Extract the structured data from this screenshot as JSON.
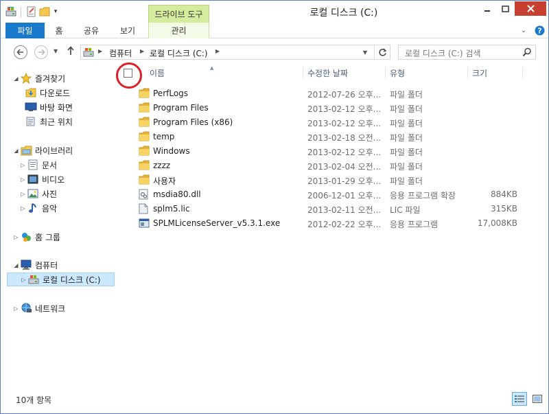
{
  "window": {
    "title": "로컬 디스크 (C:)",
    "context_tab": "드라이브 도구"
  },
  "ribbon": {
    "tabs": [
      {
        "id": "file",
        "label": "파일"
      },
      {
        "id": "home",
        "label": "홈"
      },
      {
        "id": "share",
        "label": "공유"
      },
      {
        "id": "view",
        "label": "보기"
      },
      {
        "id": "manage",
        "label": "관리"
      }
    ]
  },
  "address": {
    "breadcrumbs": [
      "컴퓨터",
      "로컬 디스크 (C:)"
    ]
  },
  "search": {
    "placeholder": "로컬 디스크 (C:) 검색"
  },
  "navpane": {
    "favorites": {
      "label": "즐겨찾기",
      "items": [
        "다운로드",
        "바탕 화면",
        "최근 위치"
      ]
    },
    "libraries": {
      "label": "라이브러리",
      "items": [
        "문서",
        "비디오",
        "사진",
        "음악"
      ]
    },
    "homegroup": {
      "label": "홈 그룹"
    },
    "computer": {
      "label": "컴퓨터",
      "items": [
        "로컬 디스크 (C:)"
      ]
    },
    "network": {
      "label": "네트워크"
    }
  },
  "columns": {
    "name": "이름",
    "modified": "수정한 날짜",
    "type": "유형",
    "size": "크기"
  },
  "files": [
    {
      "name": "PerfLogs",
      "modified": "2012-07-26 오후...",
      "type": "파일 폴더",
      "size": "",
      "icon": "folder-icon"
    },
    {
      "name": "Program Files",
      "modified": "2013-02-12 오후...",
      "type": "파일 폴더",
      "size": "",
      "icon": "folder-icon"
    },
    {
      "name": "Program Files (x86)",
      "modified": "2013-02-12 오후...",
      "type": "파일 폴더",
      "size": "",
      "icon": "folder-icon"
    },
    {
      "name": "temp",
      "modified": "2013-02-18 오전...",
      "type": "파일 폴더",
      "size": "",
      "icon": "folder-icon"
    },
    {
      "name": "Windows",
      "modified": "2013-02-12 오후...",
      "type": "파일 폴더",
      "size": "",
      "icon": "folder-icon"
    },
    {
      "name": "zzzz",
      "modified": "2013-02-04 오전...",
      "type": "파일 폴더",
      "size": "",
      "icon": "folder-icon"
    },
    {
      "name": "사용자",
      "modified": "2013-01-29 오후...",
      "type": "파일 폴더",
      "size": "",
      "icon": "folder-icon"
    },
    {
      "name": "msdia80.dll",
      "modified": "2006-12-01 오후...",
      "type": "응용 프로그램 확장",
      "size": "884KB",
      "icon": "dll-file-icon"
    },
    {
      "name": "splm5.lic",
      "modified": "2013-02-11 오전...",
      "type": "LIC 파일",
      "size": "315KB",
      "icon": "generic-file-icon"
    },
    {
      "name": "SPLMLicenseServer_v5.3.1.exe",
      "modified": "2012-02-22 오후...",
      "type": "응용 프로그램",
      "size": "17,008KB",
      "icon": "exe-file-icon"
    }
  ],
  "status": {
    "item_count": "10개 항목"
  },
  "colors": {
    "accent": "#1979ca",
    "context_tab": "#d5ec9f",
    "close_button": "#c74030",
    "selection": "#cce8ff",
    "annotation_circle": "#dd1f26"
  }
}
